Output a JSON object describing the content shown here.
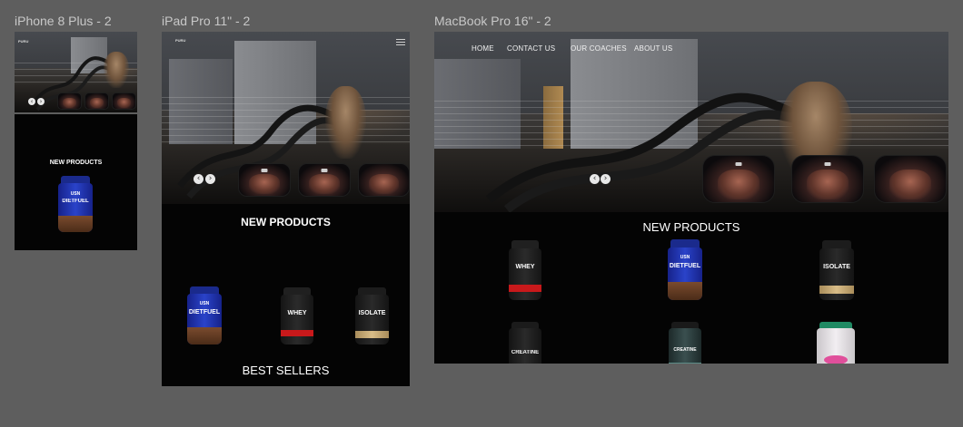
{
  "frames": {
    "iphone": {
      "label": "iPhone 8 Plus - 2",
      "brand": "PURU",
      "section_title": "NEW PRODUCTS"
    },
    "ipad": {
      "label": "iPad Pro 11\" - 2",
      "brand": "PURU",
      "section_title": "NEW PRODUCTS",
      "best_sellers_title": "BEST SELLERS"
    },
    "macbook": {
      "label": "MacBook Pro 16\" - 2",
      "nav": [
        "HOME",
        "CONTACT US",
        "OUR COACHES",
        "ABOUT US"
      ],
      "section_title": "NEW PRODUCTS"
    }
  },
  "carousel": {
    "prev_icon": "‹",
    "next_icon": "›"
  },
  "products": {
    "usn": {
      "brand": "USN",
      "name": "DIETFUEL"
    },
    "whey": {
      "name": "WHEY"
    },
    "isolate": {
      "name": "ISOLATE"
    },
    "creatine": {
      "name": "CREATINE"
    },
    "creatine2": {
      "name": "CREATINE"
    }
  },
  "colors": {
    "canvas": "#5e5e5e",
    "frame_bg": "#040404",
    "label": "#c8c8c8",
    "text": "#ffffff"
  }
}
